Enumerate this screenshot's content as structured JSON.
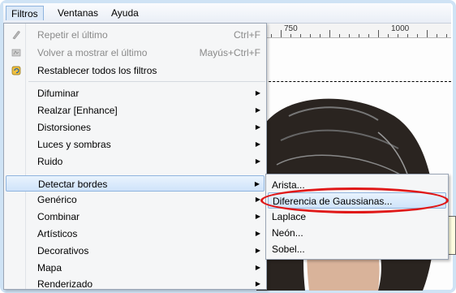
{
  "menubar": {
    "items": [
      {
        "label": "Filtros",
        "active": true
      },
      {
        "label": "Ventanas"
      },
      {
        "label": "Ayuda"
      }
    ]
  },
  "ruler": {
    "labels": [
      "750",
      "1000"
    ]
  },
  "main_menu": {
    "items": [
      {
        "label": "Repetir el último",
        "shortcut": "Ctrl+F",
        "disabled": true,
        "icon": "repeat-icon"
      },
      {
        "label": "Volver a mostrar el último",
        "shortcut": "Mayús+Ctrl+F",
        "disabled": true,
        "icon": "reshow-icon"
      },
      {
        "label": "Restablecer todos los filtros",
        "icon": "reset-filters-icon"
      },
      {
        "label": "Difuminar",
        "submenu": true
      },
      {
        "label": "Realzar [Enhance]",
        "submenu": true
      },
      {
        "label": "Distorsiones",
        "submenu": true
      },
      {
        "label": "Luces y sombras",
        "submenu": true
      },
      {
        "label": "Ruido",
        "submenu": true
      },
      {
        "label": "Detectar bordes",
        "submenu": true,
        "highlighted": true
      },
      {
        "label": "Genérico",
        "submenu": true
      },
      {
        "label": "Combinar",
        "submenu": true
      },
      {
        "label": "Artísticos",
        "submenu": true
      },
      {
        "label": "Decorativos",
        "submenu": true
      },
      {
        "label": "Mapa",
        "submenu": true
      },
      {
        "label": "Renderizado",
        "submenu": true
      }
    ]
  },
  "sub_menu": {
    "items": [
      {
        "label": "Arista..."
      },
      {
        "label": "Diferencia de Gaussianas...",
        "highlighted": true
      },
      {
        "label": "Laplace"
      },
      {
        "label": "Neón..."
      },
      {
        "label": "Sobel..."
      }
    ]
  },
  "colors": {
    "highlight_border": "#8fb4de",
    "annotation": "#e01818",
    "menu_bg": "#f5f6f7"
  }
}
